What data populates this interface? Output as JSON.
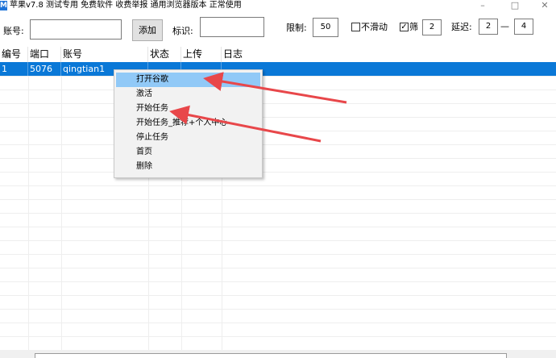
{
  "window": {
    "app_icon": "apple-icon",
    "title": "苹果v7.8 测试专用 免费软件 收费举报 通用浏览器版本 正常使用",
    "controls": [
      "minimize-icon",
      "maximize-icon",
      "close-icon"
    ]
  },
  "toolbar": {
    "account_label": "账号:",
    "account_value": "",
    "add_label": "添加",
    "tag_label": "标识:",
    "tag_value": "",
    "limit_label": "限制:",
    "limit_value": "50",
    "no_scroll_label": "不滑动",
    "no_scroll_checked": false,
    "filter_label": "筛",
    "filter_checked": true,
    "filter_value": "2",
    "delay_label": "延迟:",
    "delay_min": "2",
    "delay_sep": "—",
    "delay_max": "4"
  },
  "grid": {
    "columns": [
      "编号",
      "端口",
      "账号",
      "状态",
      "上传",
      "日志"
    ],
    "rows": [
      {
        "id": "1",
        "port": "5076",
        "account": "qingtian1",
        "status": "",
        "upload": "",
        "log": ""
      }
    ]
  },
  "context_menu": {
    "items": [
      "打开谷歌",
      "激活",
      "开始任务",
      "开始任务_推荐+个人中心",
      "停止任务",
      "首页",
      "删除"
    ],
    "highlighted_index": 0
  },
  "annotations": {
    "arrow_color": "#e8474a"
  }
}
